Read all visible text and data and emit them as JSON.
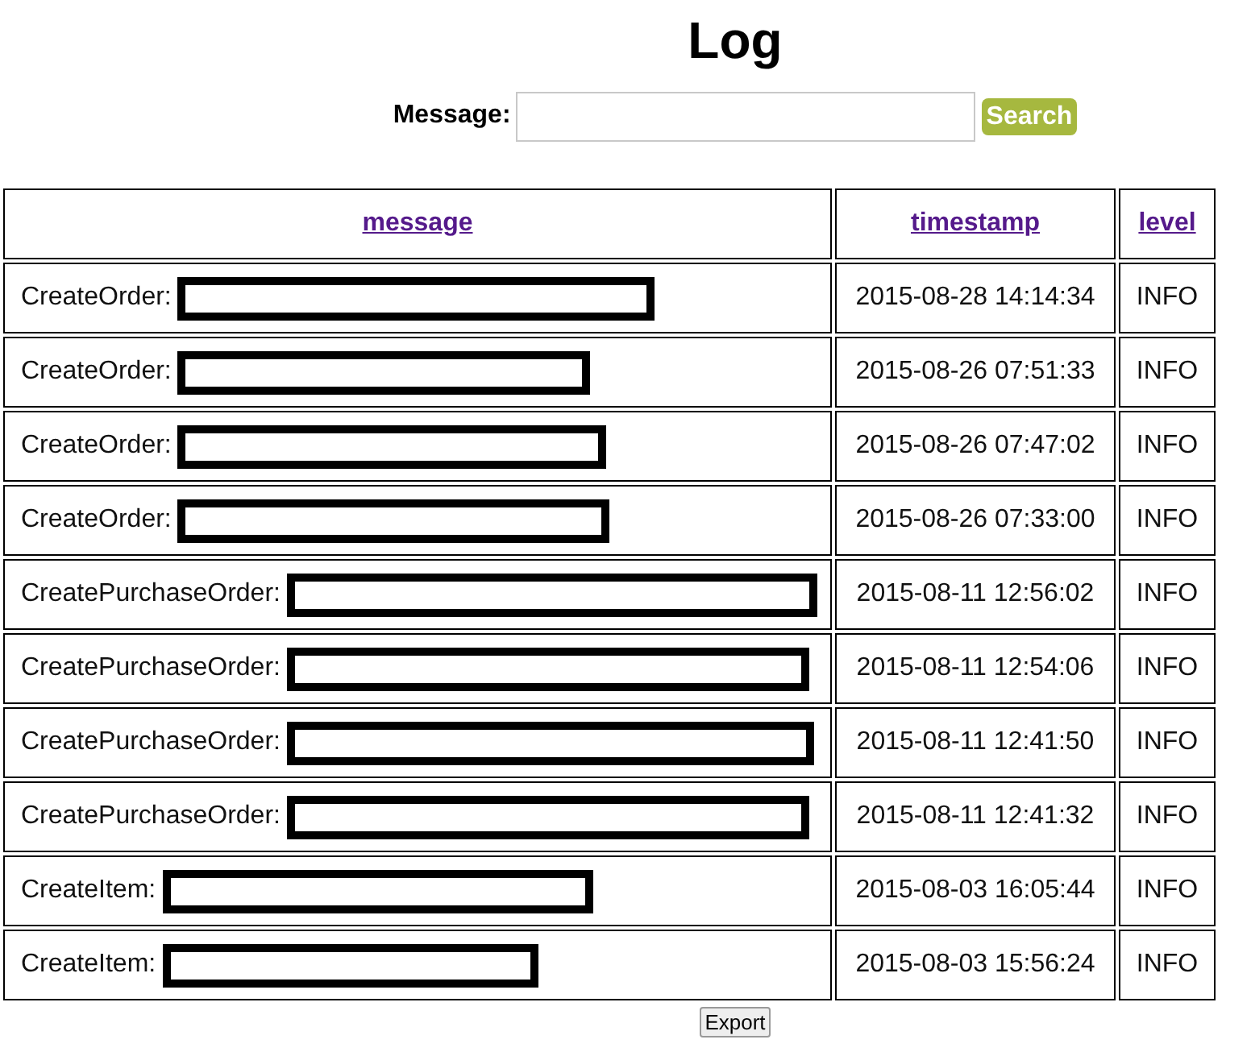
{
  "title": "Log",
  "search": {
    "label": "Message:",
    "button": "Search"
  },
  "table": {
    "columns": [
      "message",
      "timestamp",
      "level"
    ],
    "rows": [
      {
        "message": "CreateOrder:",
        "redacted": true,
        "timestamp": "2015-08-28 14:14:34",
        "level": "INFO"
      },
      {
        "message": "CreateOrder:",
        "redacted": true,
        "timestamp": "2015-08-26 07:51:33",
        "level": "INFO"
      },
      {
        "message": "CreateOrder:",
        "redacted": true,
        "timestamp": "2015-08-26 07:47:02",
        "level": "INFO"
      },
      {
        "message": "CreateOrder:",
        "redacted": true,
        "timestamp": "2015-08-26 07:33:00",
        "level": "INFO"
      },
      {
        "message": "CreatePurchaseOrder:",
        "redacted": true,
        "timestamp": "2015-08-11 12:56:02",
        "level": "INFO"
      },
      {
        "message": "CreatePurchaseOrder:",
        "redacted": true,
        "timestamp": "2015-08-11 12:54:06",
        "level": "INFO"
      },
      {
        "message": "CreatePurchaseOrder:",
        "redacted": true,
        "timestamp": "2015-08-11 12:41:50",
        "level": "INFO"
      },
      {
        "message": "CreatePurchaseOrder:",
        "redacted": true,
        "timestamp": "2015-08-11 12:41:32",
        "level": "INFO"
      },
      {
        "message": "CreateItem:",
        "redacted": true,
        "timestamp": "2015-08-03 16:05:44",
        "level": "INFO"
      },
      {
        "message": "CreateItem:",
        "redacted": true,
        "timestamp": "2015-08-03 15:56:24",
        "level": "INFO"
      }
    ]
  },
  "export_button": "Export"
}
